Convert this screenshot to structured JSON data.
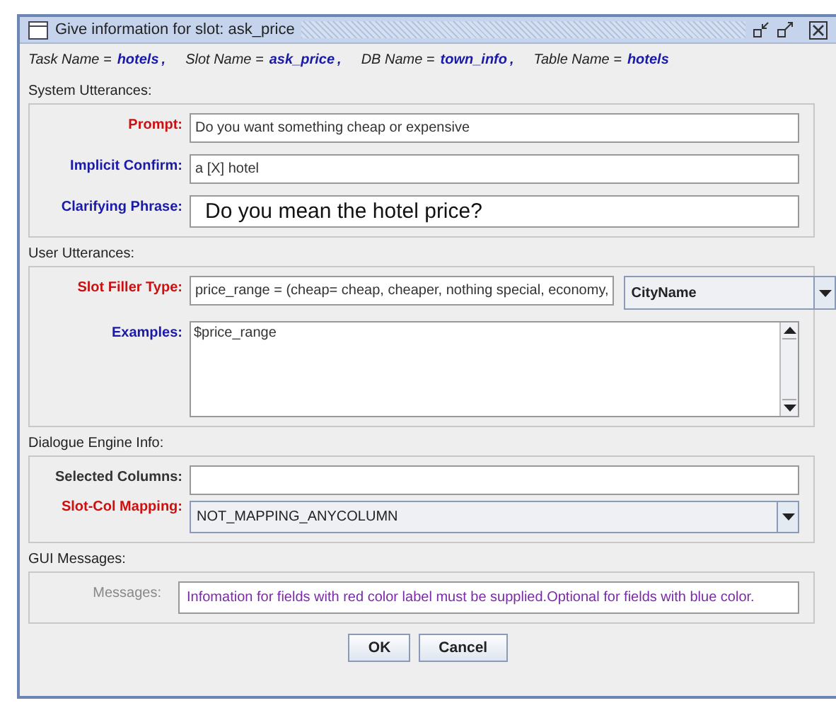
{
  "window": {
    "title": "Give information for slot: ask_price"
  },
  "info": [
    {
      "label": "Task Name =",
      "value": "hotels",
      "sep": ","
    },
    {
      "label": "Slot Name =",
      "value": "ask_price",
      "sep": ","
    },
    {
      "label": "DB Name =",
      "value": "town_info",
      "sep": ","
    },
    {
      "label": "Table Name =",
      "value": "hotels"
    }
  ],
  "sections": [
    {
      "title": "System Utterances:",
      "rows": [
        {
          "kind": "text",
          "label": "Prompt:",
          "color": "#cc1010",
          "value": "Do you want something cheap or expensive"
        },
        {
          "kind": "text",
          "label": "Implicit Confirm:",
          "color": "#1a1aa8",
          "value": "a [X] hotel"
        },
        {
          "kind": "bigtext",
          "label": "Clarifying Phrase:",
          "color": "#1a1aa8",
          "value": "Do you mean the hotel price?"
        }
      ]
    },
    {
      "title": "User Utterances:",
      "rows": [
        {
          "kind": "text_combo",
          "label": "Slot Filler Type:",
          "color": "#cc1010",
          "value": "price_range = (cheap= cheap, cheaper, nothing special, economy,",
          "combo": "CityName"
        },
        {
          "kind": "area",
          "label": "Examples:",
          "color": "#1a1aa8",
          "value": "$price_range"
        }
      ]
    },
    {
      "title": "Dialogue Engine Info:",
      "rows": [
        {
          "kind": "text",
          "label": "Selected Columns:",
          "color": "#333333"
        },
        {
          "kind": "combo",
          "label": "Slot-Col Mapping:",
          "color": "#cc1010",
          "combo": "NOT_MAPPING_ANYCOLUMN"
        }
      ]
    },
    {
      "title": "GUI Messages:",
      "rows": [
        {
          "kind": "message",
          "label": "Messages:",
          "color": "#888888",
          "value": "Infomation for fields with red color label must be supplied.Optional for fields with blue color."
        }
      ]
    }
  ],
  "buttons": [
    "OK",
    "Cancel"
  ]
}
